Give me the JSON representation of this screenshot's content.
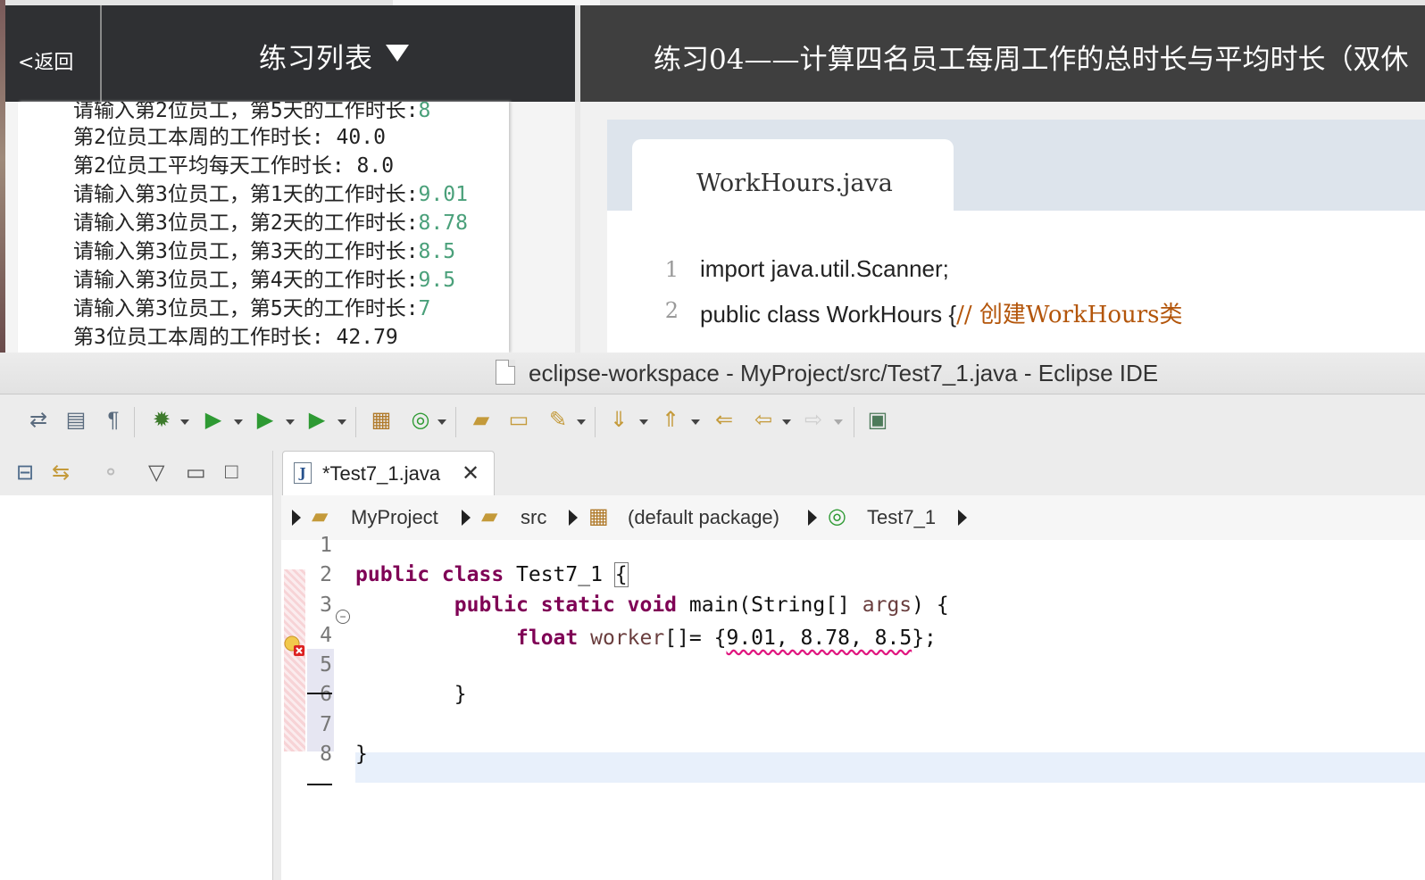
{
  "site": {
    "back_label": "<返回",
    "list_title": "练习列表",
    "exercise_title": "练习04——计算四名员工每周工作的总时长与平均时长（双休",
    "console_lines": [
      {
        "text": "请输入第2位员工，第5天的工作时长:",
        "value": "8"
      },
      {
        "text": "第2位员工本周的工作时长: 40.0",
        "value": ""
      },
      {
        "text": "第2位员工平均每天工作时长: 8.0",
        "value": ""
      },
      {
        "text": "请输入第3位员工，第1天的工作时长:",
        "value": "9.01"
      },
      {
        "text": "请输入第3位员工，第2天的工作时长:",
        "value": "8.78"
      },
      {
        "text": "请输入第3位员工，第3天的工作时长:",
        "value": "8.5"
      },
      {
        "text": "请输入第3位员工，第4天的工作时长:",
        "value": "9.5"
      },
      {
        "text": "请输入第3位员工，第5天的工作时长:",
        "value": "7"
      },
      {
        "text": "第3位员工本周的工作时长: 42.79",
        "value": ""
      }
    ],
    "file_tab": "WorkHours.java",
    "code_lines": [
      {
        "n": "1",
        "code": "import java.util.Scanner;",
        "comment": ""
      },
      {
        "n": "2",
        "code": "public class WorkHours {",
        "comment": "// 创建WorkHours类"
      }
    ]
  },
  "eclipse": {
    "window_title": "eclipse-workspace - MyProject/src/Test7_1.java - Eclipse IDE",
    "editor_tab": "*Test7_1.java",
    "breadcrumb": [
      "MyProject",
      "src",
      "(default package)",
      "Test7_1"
    ],
    "line_numbers": [
      "1",
      "2",
      "3",
      "4",
      "5",
      "6",
      "7",
      "8"
    ],
    "code": {
      "l2_kw": "public class",
      "l2_rest": " Test7_1 ",
      "l2_brace": "{",
      "l3_kw": "public static void",
      "l3_rest": " main(String[] ",
      "l3_arg": "args",
      "l3_end": ") {",
      "l4_kw": "float",
      "l4_id": "worker",
      "l4_mid": "[]= {",
      "l4_vals": "9.01, 8.78, 8.5",
      "l4_end": "};",
      "l6": "}",
      "l8": "}"
    }
  }
}
